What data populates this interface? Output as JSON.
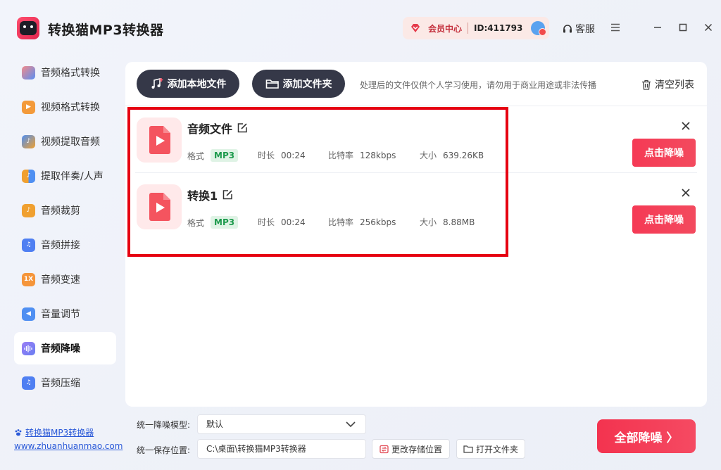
{
  "app": {
    "title": "转换猫MP3转换器",
    "logo_text": "转换猫"
  },
  "header": {
    "vip_label": "会员中心",
    "user_id": "ID:411793",
    "service_label": "客服"
  },
  "sidebar": {
    "items": [
      {
        "label": "音频格式转换",
        "icon": "audio-convert-icon",
        "color": "#f16a6a"
      },
      {
        "label": "视频格式转换",
        "icon": "video-convert-icon",
        "color": "#f39a3a"
      },
      {
        "label": "视频提取音频",
        "icon": "video-extract-audio-icon",
        "color": "#4f8ff2"
      },
      {
        "label": "提取伴奏/人声",
        "icon": "extract-vocals-icon",
        "color": "#f0a030"
      },
      {
        "label": "音频裁剪",
        "icon": "audio-cut-icon",
        "color": "#f0a030"
      },
      {
        "label": "音频拼接",
        "icon": "audio-join-icon",
        "color": "#4f7ff2"
      },
      {
        "label": "音频变速",
        "icon": "speed-icon",
        "color": "#f5953a"
      },
      {
        "label": "音量调节",
        "icon": "volume-icon",
        "color": "#4f8ff2"
      },
      {
        "label": "音频降噪",
        "icon": "denoise-icon",
        "color": "#7f6ef2"
      },
      {
        "label": "音频压缩",
        "icon": "compress-icon",
        "color": "#4f7ff2"
      }
    ],
    "speed_icon_text": "1X",
    "active_index": 8
  },
  "brand": {
    "name": "转换猫MP3转换器",
    "url": "www.zhuanhuanmao.com"
  },
  "toolbar": {
    "add_file_label": "添加本地文件",
    "add_folder_label": "添加文件夹",
    "notice": "处理后的文件仅供个人学习使用，请勿用于商业用途或非法传播",
    "clear_label": "清空列表"
  },
  "files": [
    {
      "name": "音频文件",
      "format_label": "格式",
      "format": "MP3",
      "duration_label": "时长",
      "duration": "00:24",
      "bitrate_label": "比特率",
      "bitrate": "128kbps",
      "size_label": "大小",
      "size": "639.26KB",
      "action": "点击降噪"
    },
    {
      "name": "转换1",
      "format_label": "格式",
      "format": "MP3",
      "duration_label": "时长",
      "duration": "00:24",
      "bitrate_label": "比特率",
      "bitrate": "256kbps",
      "size_label": "大小",
      "size": "8.88MB",
      "action": "点击降噪"
    }
  ],
  "settings": {
    "model_label": "统一降噪模型:",
    "model_value": "默认",
    "path_label": "统一保存位置:",
    "path_value": "C:\\桌面\\转换猫MP3转换器",
    "change_path_label": "更改存储位置",
    "open_folder_label": "打开文件夹"
  },
  "primary_action": {
    "label": "全部降噪 〉"
  },
  "colors": {
    "accent": "#f3334f",
    "dark_button": "#353848",
    "highlight_border": "#e60012",
    "badge_bg": "#dff3e5",
    "badge_text": "#1c9a4c"
  }
}
